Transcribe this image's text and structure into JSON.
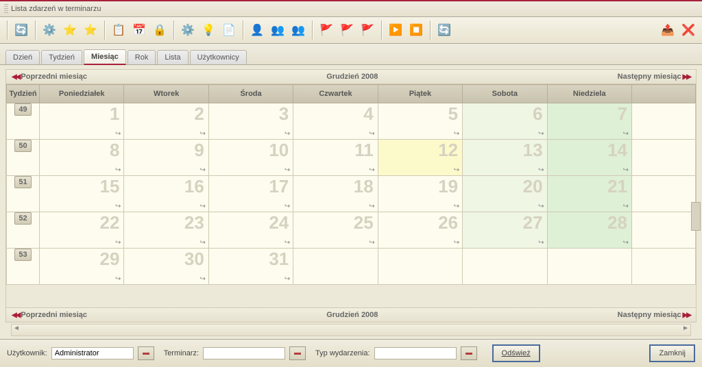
{
  "window_title": "Lista zdarzeń w terminarzu",
  "tabs": [
    "Dzień",
    "Tydzień",
    "Miesiąc",
    "Rok",
    "Lista",
    "Użytkownicy"
  ],
  "active_tab": 2,
  "nav": {
    "prev": "Poprzedni miesiąc",
    "title": "Grudzień 2008",
    "next": "Następny miesiąc"
  },
  "week_header": "Tydzień",
  "day_headers": [
    "Poniedziałek",
    "Wtorek",
    "Środa",
    "Czwartek",
    "Piątek",
    "Sobota",
    "Niedziela"
  ],
  "weeks": [
    {
      "num": "49",
      "days": [
        {
          "d": "1"
        },
        {
          "d": "2"
        },
        {
          "d": "3"
        },
        {
          "d": "4"
        },
        {
          "d": "5"
        },
        {
          "d": "6",
          "wknd": true
        },
        {
          "d": "7",
          "sun": true
        }
      ]
    },
    {
      "num": "50",
      "days": [
        {
          "d": "8"
        },
        {
          "d": "9"
        },
        {
          "d": "10"
        },
        {
          "d": "11"
        },
        {
          "d": "12",
          "today": true
        },
        {
          "d": "13",
          "wknd": true
        },
        {
          "d": "14",
          "sun": true
        }
      ]
    },
    {
      "num": "51",
      "days": [
        {
          "d": "15"
        },
        {
          "d": "16"
        },
        {
          "d": "17"
        },
        {
          "d": "18"
        },
        {
          "d": "19"
        },
        {
          "d": "20",
          "wknd": true
        },
        {
          "d": "21",
          "sun": true
        }
      ]
    },
    {
      "num": "52",
      "days": [
        {
          "d": "22"
        },
        {
          "d": "23"
        },
        {
          "d": "24"
        },
        {
          "d": "25"
        },
        {
          "d": "26"
        },
        {
          "d": "27",
          "wknd": true
        },
        {
          "d": "28",
          "sun": true
        }
      ]
    },
    {
      "num": "53",
      "days": [
        {
          "d": "29"
        },
        {
          "d": "30"
        },
        {
          "d": "31"
        },
        null,
        null,
        null,
        null
      ]
    }
  ],
  "filter": {
    "user_label": "Użytkownik:",
    "user_value": "Administrator",
    "cal_label": "Terminarz:",
    "cal_value": "",
    "type_label": "Typ wydarzenia:",
    "type_value": "",
    "refresh": "Odśwież",
    "close": "Zamknij"
  },
  "icons": {
    "refresh": "🔄",
    "gear": "⚙️",
    "star_l": "⭐",
    "star_r": "⭐",
    "note": "📋",
    "cal": "📅",
    "lock": "🔒",
    "gear2": "⚙️",
    "bulb": "💡",
    "doc": "📄",
    "user": "👤",
    "grp1": "👥",
    "grp2": "👥",
    "flag1": "🚩",
    "flag2": "🚩",
    "flag3": "🚩",
    "play": "▶️",
    "stop": "⏹️",
    "circ": "🔄",
    "export": "📤",
    "x": "❌"
  }
}
